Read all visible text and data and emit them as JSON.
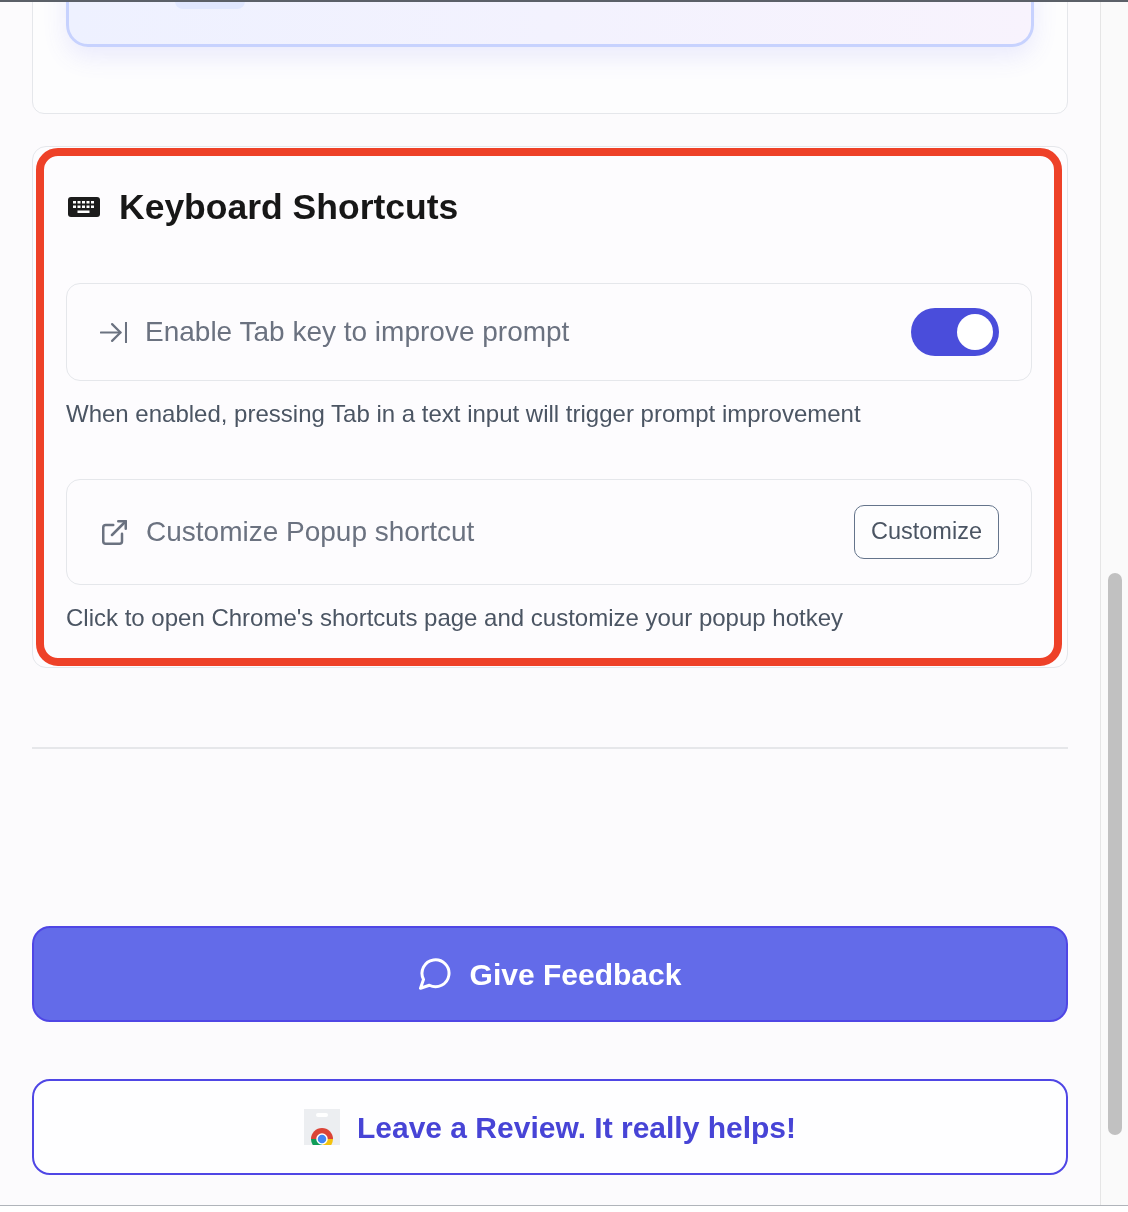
{
  "keyboard_shortcuts": {
    "highlighted": true,
    "title": "Keyboard Shortcuts",
    "items": [
      {
        "kind": "toggle",
        "label": "Enable Tab key to improve prompt",
        "on": true,
        "description": "When enabled, pressing Tab in a text input will trigger prompt improvement"
      },
      {
        "kind": "action",
        "label": "Customize Popup shortcut",
        "button": "Customize",
        "description": "Click to open Chrome's shortcuts page and customize your popup hotkey"
      }
    ]
  },
  "buttons": [
    {
      "kind": "primary",
      "label": "Give Feedback"
    },
    {
      "kind": "outline",
      "label": "Leave a Review. It really helps!"
    }
  ]
}
